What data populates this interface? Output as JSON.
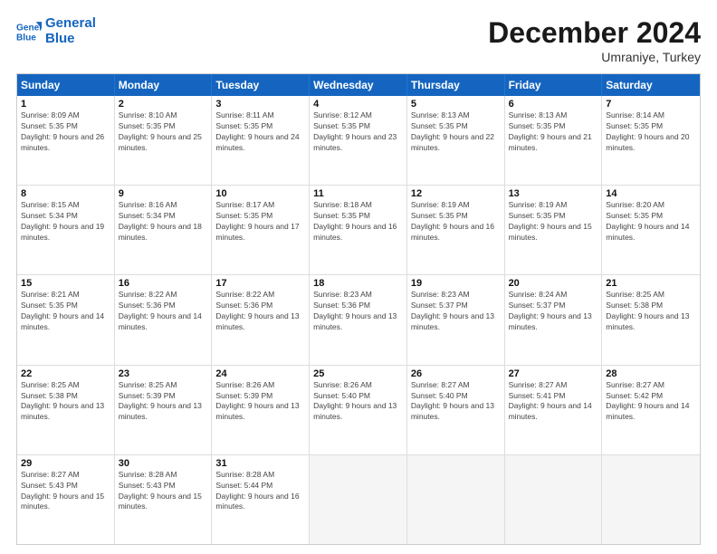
{
  "header": {
    "logo_line1": "General",
    "logo_line2": "Blue",
    "month": "December 2024",
    "location": "Umraniye, Turkey"
  },
  "days": [
    "Sunday",
    "Monday",
    "Tuesday",
    "Wednesday",
    "Thursday",
    "Friday",
    "Saturday"
  ],
  "weeks": [
    [
      {
        "day": "1",
        "sunrise": "8:09 AM",
        "sunset": "5:35 PM",
        "daylight": "9 hours and 26 minutes."
      },
      {
        "day": "2",
        "sunrise": "8:10 AM",
        "sunset": "5:35 PM",
        "daylight": "9 hours and 25 minutes."
      },
      {
        "day": "3",
        "sunrise": "8:11 AM",
        "sunset": "5:35 PM",
        "daylight": "9 hours and 24 minutes."
      },
      {
        "day": "4",
        "sunrise": "8:12 AM",
        "sunset": "5:35 PM",
        "daylight": "9 hours and 23 minutes."
      },
      {
        "day": "5",
        "sunrise": "8:13 AM",
        "sunset": "5:35 PM",
        "daylight": "9 hours and 22 minutes."
      },
      {
        "day": "6",
        "sunrise": "8:13 AM",
        "sunset": "5:35 PM",
        "daylight": "9 hours and 21 minutes."
      },
      {
        "day": "7",
        "sunrise": "8:14 AM",
        "sunset": "5:35 PM",
        "daylight": "9 hours and 20 minutes."
      }
    ],
    [
      {
        "day": "8",
        "sunrise": "8:15 AM",
        "sunset": "5:34 PM",
        "daylight": "9 hours and 19 minutes."
      },
      {
        "day": "9",
        "sunrise": "8:16 AM",
        "sunset": "5:34 PM",
        "daylight": "9 hours and 18 minutes."
      },
      {
        "day": "10",
        "sunrise": "8:17 AM",
        "sunset": "5:35 PM",
        "daylight": "9 hours and 17 minutes."
      },
      {
        "day": "11",
        "sunrise": "8:18 AM",
        "sunset": "5:35 PM",
        "daylight": "9 hours and 16 minutes."
      },
      {
        "day": "12",
        "sunrise": "8:19 AM",
        "sunset": "5:35 PM",
        "daylight": "9 hours and 16 minutes."
      },
      {
        "day": "13",
        "sunrise": "8:19 AM",
        "sunset": "5:35 PM",
        "daylight": "9 hours and 15 minutes."
      },
      {
        "day": "14",
        "sunrise": "8:20 AM",
        "sunset": "5:35 PM",
        "daylight": "9 hours and 14 minutes."
      }
    ],
    [
      {
        "day": "15",
        "sunrise": "8:21 AM",
        "sunset": "5:35 PM",
        "daylight": "9 hours and 14 minutes."
      },
      {
        "day": "16",
        "sunrise": "8:22 AM",
        "sunset": "5:36 PM",
        "daylight": "9 hours and 14 minutes."
      },
      {
        "day": "17",
        "sunrise": "8:22 AM",
        "sunset": "5:36 PM",
        "daylight": "9 hours and 13 minutes."
      },
      {
        "day": "18",
        "sunrise": "8:23 AM",
        "sunset": "5:36 PM",
        "daylight": "9 hours and 13 minutes."
      },
      {
        "day": "19",
        "sunrise": "8:23 AM",
        "sunset": "5:37 PM",
        "daylight": "9 hours and 13 minutes."
      },
      {
        "day": "20",
        "sunrise": "8:24 AM",
        "sunset": "5:37 PM",
        "daylight": "9 hours and 13 minutes."
      },
      {
        "day": "21",
        "sunrise": "8:25 AM",
        "sunset": "5:38 PM",
        "daylight": "9 hours and 13 minutes."
      }
    ],
    [
      {
        "day": "22",
        "sunrise": "8:25 AM",
        "sunset": "5:38 PM",
        "daylight": "9 hours and 13 minutes."
      },
      {
        "day": "23",
        "sunrise": "8:25 AM",
        "sunset": "5:39 PM",
        "daylight": "9 hours and 13 minutes."
      },
      {
        "day": "24",
        "sunrise": "8:26 AM",
        "sunset": "5:39 PM",
        "daylight": "9 hours and 13 minutes."
      },
      {
        "day": "25",
        "sunrise": "8:26 AM",
        "sunset": "5:40 PM",
        "daylight": "9 hours and 13 minutes."
      },
      {
        "day": "26",
        "sunrise": "8:27 AM",
        "sunset": "5:40 PM",
        "daylight": "9 hours and 13 minutes."
      },
      {
        "day": "27",
        "sunrise": "8:27 AM",
        "sunset": "5:41 PM",
        "daylight": "9 hours and 14 minutes."
      },
      {
        "day": "28",
        "sunrise": "8:27 AM",
        "sunset": "5:42 PM",
        "daylight": "9 hours and 14 minutes."
      }
    ],
    [
      {
        "day": "29",
        "sunrise": "8:27 AM",
        "sunset": "5:43 PM",
        "daylight": "9 hours and 15 minutes."
      },
      {
        "day": "30",
        "sunrise": "8:28 AM",
        "sunset": "5:43 PM",
        "daylight": "9 hours and 15 minutes."
      },
      {
        "day": "31",
        "sunrise": "8:28 AM",
        "sunset": "5:44 PM",
        "daylight": "9 hours and 16 minutes."
      },
      null,
      null,
      null,
      null
    ]
  ]
}
